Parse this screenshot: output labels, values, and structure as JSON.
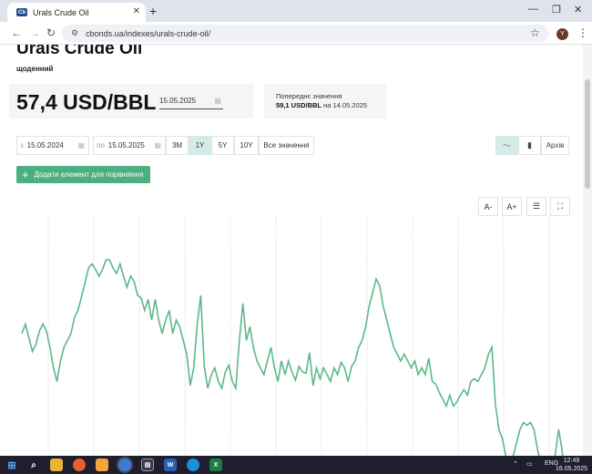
{
  "browser": {
    "tab_title": "Urals Crude Oil",
    "favicon_text": "Cb",
    "url": "cbonds.ua/indexes/urals-crude-oil/",
    "profile_initial": "Y"
  },
  "page": {
    "title": "Urals Crude Oil",
    "frequency": "щоденний",
    "price": "57,4 USD/BBL",
    "price_date": "15.05.2025",
    "prev_label": "Попереднє значення",
    "prev_value": "59,1 USD/BBL",
    "prev_on": "на",
    "prev_date": "14.05.2025"
  },
  "filters": {
    "from_label": "з",
    "from_date": "15.05.2024",
    "to_label": "по",
    "to_date": "15.05.2025",
    "periods": [
      "3M",
      "1Y",
      "5Y",
      "10Y",
      "Все значення"
    ],
    "active_period": "1Y",
    "archive_label": "Архів"
  },
  "compare_button": "Додати елемент для порівняння",
  "chart_tools": {
    "font_smaller": "A-",
    "font_larger": "A+"
  },
  "chart_data": {
    "type": "line",
    "title": "",
    "xlabel": "",
    "ylabel": "",
    "x_range": [
      "2024-05-15",
      "2025-05-15"
    ],
    "color": "#5cb88a",
    "grid": "vertical dotted lines",
    "series": [
      {
        "values": [
          80.4,
          81.8,
          79.8,
          77.8,
          78.8,
          80.8,
          81.8,
          80.8,
          78.4,
          75.4,
          73.4,
          76.4,
          78.4,
          79.4,
          80.4,
          82.8,
          83.8,
          85.8,
          87.8,
          90.0,
          90.6,
          89.8,
          88.8,
          89.8,
          91.2,
          91.2,
          90.0,
          89.2,
          90.6,
          88.8,
          87.2,
          88.8,
          88.0,
          86.0,
          85.6,
          83.8,
          85.4,
          82.4,
          85.4,
          82.4,
          80.4,
          82.4,
          83.8,
          80.4,
          82.4,
          81.4,
          79.4,
          77.4,
          72.8,
          75.4,
          81.8,
          86.0,
          75.6,
          72.4,
          74.4,
          75.4,
          73.4,
          72.4,
          74.8,
          75.8,
          73.4,
          72.4,
          79.4,
          84.8,
          79.4,
          81.4,
          78.4,
          76.4,
          75.4,
          74.4,
          76.4,
          78.4,
          75.4,
          73.4,
          76.4,
          74.4,
          76.4,
          74.8,
          73.6,
          75.6,
          74.8,
          74.6,
          77.6,
          72.8,
          75.4,
          73.8,
          75.4,
          74.4,
          73.4,
          75.4,
          74.4,
          76.2,
          75.4,
          73.4,
          75.6,
          76.4,
          78.4,
          79.4,
          81.4,
          84.4,
          86.4,
          88.4,
          87.4,
          84.4,
          82.4,
          80.4,
          78.4,
          77.4,
          76.4,
          77.4,
          76.4,
          75.4,
          76.4,
          74.4,
          75.4,
          74.4,
          76.8,
          73.4,
          73.0,
          71.8,
          70.8,
          69.8,
          71.4,
          69.8,
          70.4,
          71.4,
          72.2,
          71.4,
          73.4,
          73.8,
          73.4,
          74.4,
          75.4,
          77.4,
          78.4,
          70.0,
          66.4,
          65.0,
          62.4,
          60.8,
          62.4,
          64.4,
          66.4,
          67.4,
          67.0,
          67.4,
          66.4,
          63.4,
          61.4,
          59.8,
          60.4,
          61.4,
          62.4,
          66.4,
          63.4,
          57.4
        ]
      }
    ]
  },
  "taskbar": {
    "lang": "ENG",
    "time": "12:49",
    "date": "16.05.2025"
  }
}
